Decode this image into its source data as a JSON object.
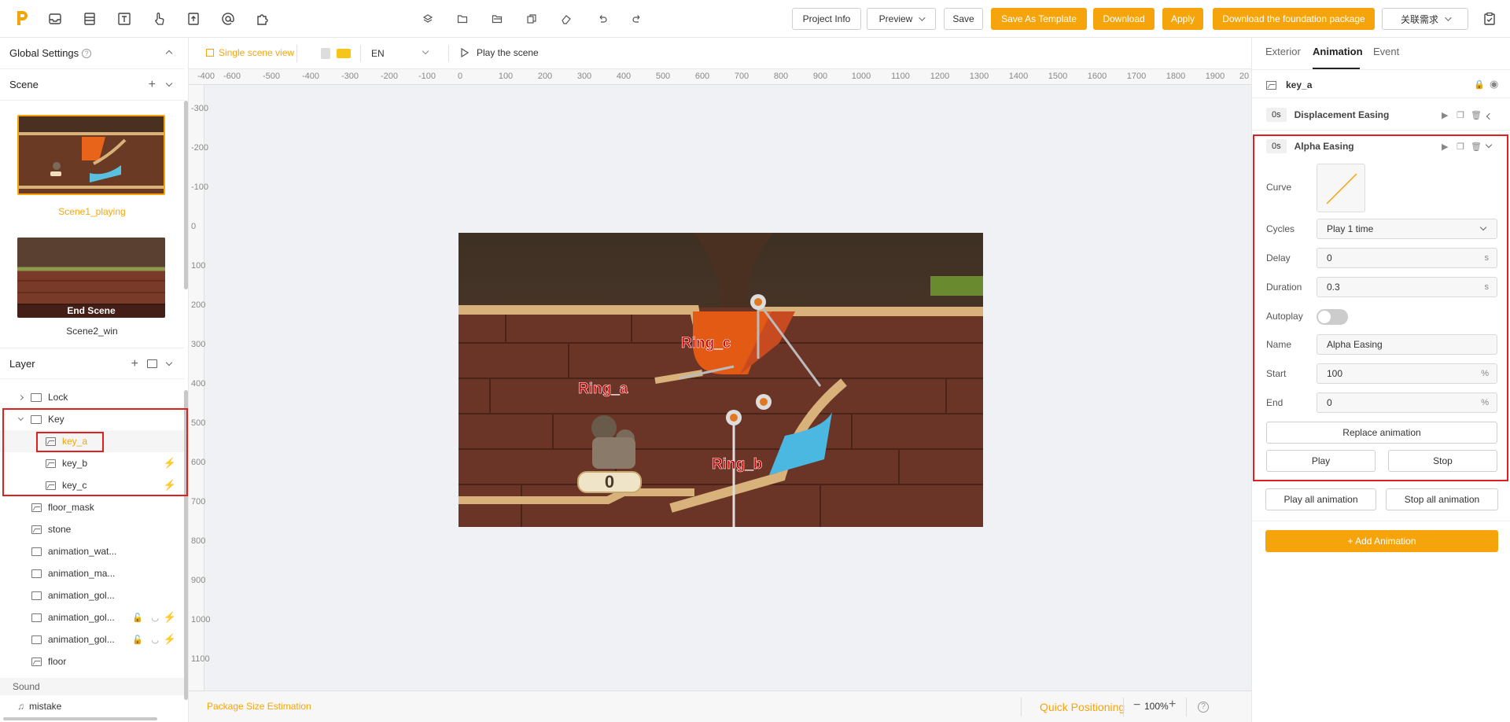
{
  "topbar": {
    "project_info": "Project Info",
    "preview": "Preview",
    "save": "Save",
    "save_as_template": "Save As Template",
    "download": "Download",
    "apply": "Apply",
    "download_foundation": "Download the foundation package",
    "related_req": "关联需求",
    "accent_color": "#f5a50b"
  },
  "left": {
    "global_settings": "Global Settings",
    "scene_title": "Scene",
    "scenes": [
      {
        "label": "Scene1_playing",
        "active": true
      },
      {
        "label": "Scene2_win",
        "overlay": "End Scene"
      }
    ],
    "layer_title": "Layer",
    "layers": [
      {
        "label": "Lock",
        "type": "folder"
      },
      {
        "label": "Key",
        "type": "folder"
      },
      {
        "label": "key_a",
        "type": "image"
      },
      {
        "label": "key_b",
        "type": "image"
      },
      {
        "label": "key_c",
        "type": "image"
      },
      {
        "label": "floor_mask",
        "type": "image"
      },
      {
        "label": "stone",
        "type": "image"
      },
      {
        "label": "animation_wat...",
        "type": "anim"
      },
      {
        "label": "animation_ma...",
        "type": "anim"
      },
      {
        "label": "animation_gol...",
        "type": "anim"
      },
      {
        "label": "animation_gol...",
        "type": "anim"
      },
      {
        "label": "animation_gol...",
        "type": "anim"
      },
      {
        "label": "floor",
        "type": "image"
      }
    ],
    "sound_title": "Sound",
    "sound_item": "mistake"
  },
  "center": {
    "single_scene_view": "Single scene view",
    "language": "EN",
    "play_scene": "Play the scene",
    "ruler_x": [
      "-400",
      "-600",
      "-500",
      "-400",
      "-300",
      "-200",
      "-100",
      "0",
      "100",
      "200",
      "300",
      "400",
      "500",
      "600",
      "700",
      "800",
      "900",
      "1000",
      "1100",
      "1200",
      "1300",
      "1400",
      "1500",
      "1600",
      "1700",
      "1800",
      "1900",
      "20"
    ],
    "ruler_y": [
      "-300",
      "-200",
      "-100",
      "0",
      "100",
      "200",
      "300",
      "400",
      "500",
      "600",
      "700",
      "800",
      "900",
      "1000",
      "1100"
    ],
    "package_size": "Package Size Estimation",
    "quick_positioning": "Quick Positioning",
    "zoom": "100%",
    "game": {
      "ring_a": "Ring_a",
      "ring_b": "Ring_b",
      "ring_c": "Ring_c",
      "score": "0"
    }
  },
  "right": {
    "tabs": [
      "Exterior",
      "Animation",
      "Event"
    ],
    "layer_name": "key_a",
    "anim1": {
      "time": "0s",
      "name": "Displacement Easing"
    },
    "anim2": {
      "time": "0s",
      "name": "Alpha Easing"
    },
    "props": {
      "curve_label": "Curve",
      "cycles_label": "Cycles",
      "cycles_value": "Play 1 time",
      "delay_label": "Delay",
      "delay_value": "0",
      "duration_label": "Duration",
      "duration_value": "0.3",
      "autoplay_label": "Autoplay",
      "name_label": "Name",
      "name_value": "Alpha Easing",
      "start_label": "Start",
      "start_value": "100",
      "end_label": "End",
      "end_value": "0",
      "unit_s": "s",
      "unit_pct": "%"
    },
    "replace_animation": "Replace animation",
    "play": "Play",
    "stop": "Stop",
    "play_all": "Play all animation",
    "stop_all": "Stop all animation",
    "add_animation": "+ Add Animation"
  }
}
